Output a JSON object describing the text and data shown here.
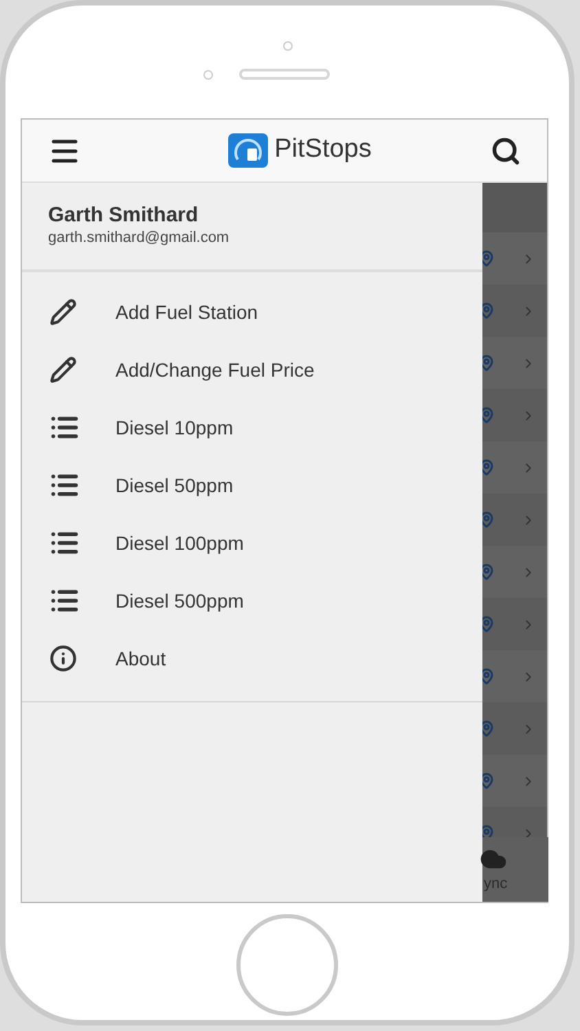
{
  "app_bar": {
    "title": "PitStops"
  },
  "drawer": {
    "user_name": "Garth Smithard",
    "user_email": "garth.smithard@gmail.com",
    "items": [
      {
        "label": "Add Fuel Station",
        "kind": "edit"
      },
      {
        "label": "Add/Change Fuel Price",
        "kind": "edit"
      },
      {
        "label": "Diesel 10ppm",
        "kind": "list"
      },
      {
        "label": "Diesel 50ppm",
        "kind": "list"
      },
      {
        "label": "Diesel 100ppm",
        "kind": "list"
      },
      {
        "label": "Diesel 500ppm",
        "kind": "list"
      },
      {
        "label": "About",
        "kind": "info"
      }
    ]
  },
  "bottom_bar": {
    "sync_label": "ync"
  }
}
